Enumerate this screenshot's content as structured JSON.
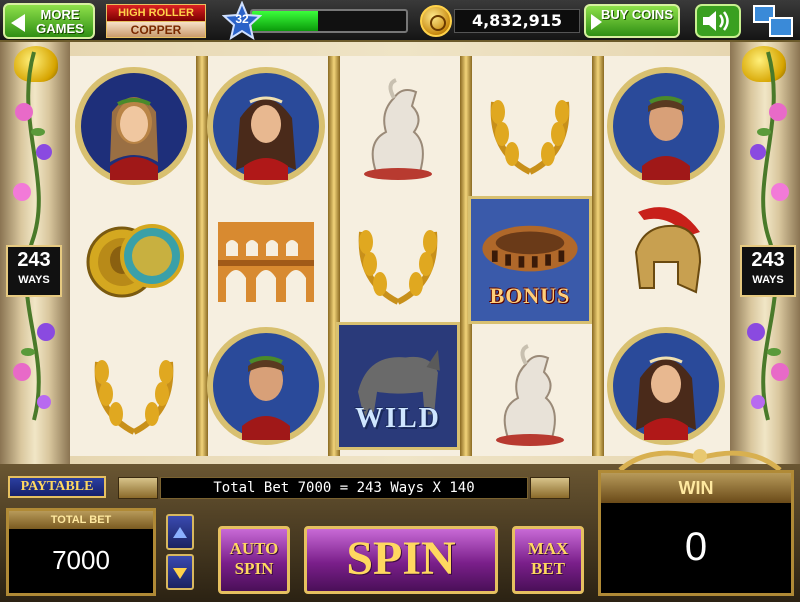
{
  "topbar": {
    "more_games": "MORE GAMES",
    "tier_title": "HIGH ROLLER",
    "tier_level": "COPPER",
    "player_level": "32",
    "xp_progress": 0.43,
    "coins": "4,832,915",
    "buy_coins": "BUY COINS"
  },
  "ways": {
    "count": "243",
    "label": "WAYS"
  },
  "reels": {
    "bonus_label": "BONUS",
    "wild_label": "WILD"
  },
  "controls": {
    "paytable": "PAYTABLE",
    "bet_summary": "Total Bet 7000 = 243 Ways X 140",
    "total_bet_label": "TOTAL BET",
    "total_bet_value": "7000",
    "auto_spin": "AUTO SPIN",
    "spin": "SPIN",
    "max_bet": "MAX BET",
    "win_label": "WIN",
    "win_value": "0"
  },
  "colors": {
    "button_green": "#5fc02a",
    "xp_green": "#22cc22",
    "spin_purple": "#9a3aa8",
    "trim_gold": "#e6c060"
  }
}
